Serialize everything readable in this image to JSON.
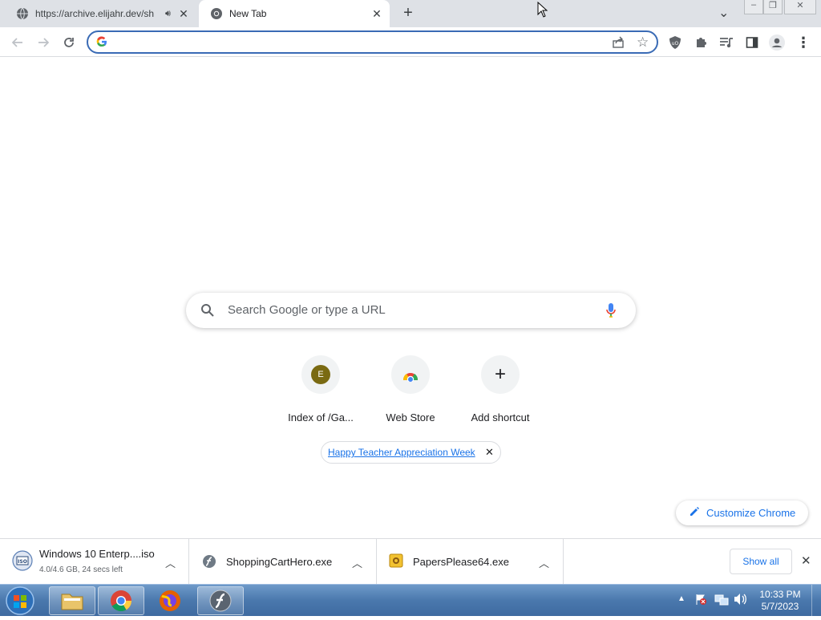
{
  "tabs": [
    {
      "title": "https://archive.elijahr.dev/sh",
      "active": false,
      "audio": true
    },
    {
      "title": "New Tab",
      "active": true
    }
  ],
  "window_controls": {
    "tab_search": "⌄",
    "minimize": "–",
    "restore": "❐",
    "close": "✕"
  },
  "omnibox": {
    "value": "",
    "placeholder": ""
  },
  "ntp": {
    "search_placeholder": "Search Google or type a URL",
    "shortcuts": [
      {
        "label": "Index of /Ga...",
        "avatar_letter": "E",
        "avatar_color": "#7a6a12"
      },
      {
        "label": "Web Store"
      },
      {
        "label": "Add shortcut",
        "icon": "+"
      }
    ],
    "promo": "Happy Teacher Appreciation Week",
    "customize": "Customize Chrome"
  },
  "downloads": [
    {
      "name": "Windows 10 Enterp....iso",
      "status": "4.0/4.6 GB, 24 secs left",
      "icon": "disc-image-icon"
    },
    {
      "name": "ShoppingCartHero.exe",
      "icon": "flash-icon"
    },
    {
      "name": "PapersPlease64.exe",
      "icon": "game-icon"
    }
  ],
  "downloads_shelf": {
    "show_all": "Show all"
  },
  "taskbar": {
    "time": "10:33 PM",
    "date": "5/7/2023"
  },
  "colors": {
    "accent": "#1a73e8",
    "tabstrip": "#dee1e6",
    "omnibox_border": "#3a6bb5"
  }
}
